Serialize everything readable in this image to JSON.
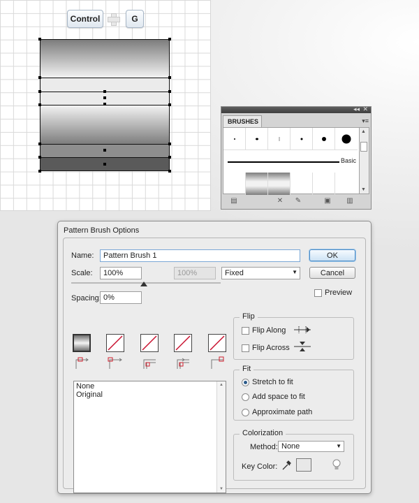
{
  "shortcut": {
    "key1": "Control",
    "key2": "G"
  },
  "brushes_panel": {
    "tab": "BRUSHES",
    "collapse_glyph": "◂◂",
    "close_glyph": "✕",
    "menu_glyph": "▾≡",
    "stroke_label": "Basic",
    "footer_icons": [
      "brush-libraries-icon",
      "remove-stroke-icon",
      "brush-options-icon",
      "new-brush-icon",
      "delete-brush-icon"
    ]
  },
  "dialog": {
    "title": "Pattern Brush Options",
    "name_label": "Name:",
    "name_value": "Pattern Brush 1",
    "ok_label": "OK",
    "cancel_label": "Cancel",
    "scale_label": "Scale:",
    "scale_value": "100%",
    "scale_disabled_value": "100%",
    "scale_mode": "Fixed",
    "preview_label": "Preview",
    "spacing_label": "Spacing:",
    "spacing_value": "0%",
    "tile_list": [
      "None",
      "Original"
    ],
    "flip": {
      "title": "Flip",
      "along": "Flip Along",
      "across": "Flip Across"
    },
    "fit": {
      "title": "Fit",
      "options": [
        "Stretch to fit",
        "Add space to fit",
        "Approximate path"
      ],
      "selected": 0
    },
    "colorization": {
      "title": "Colorization",
      "method_label": "Method:",
      "method_value": "None",
      "key_color_label": "Key Color:",
      "key_color_swatch": "#e8e8e8"
    }
  },
  "colors": {
    "accent": "#4e8cc5",
    "tile_slash": "#c8102e",
    "tile_marker": "#d0202e"
  }
}
